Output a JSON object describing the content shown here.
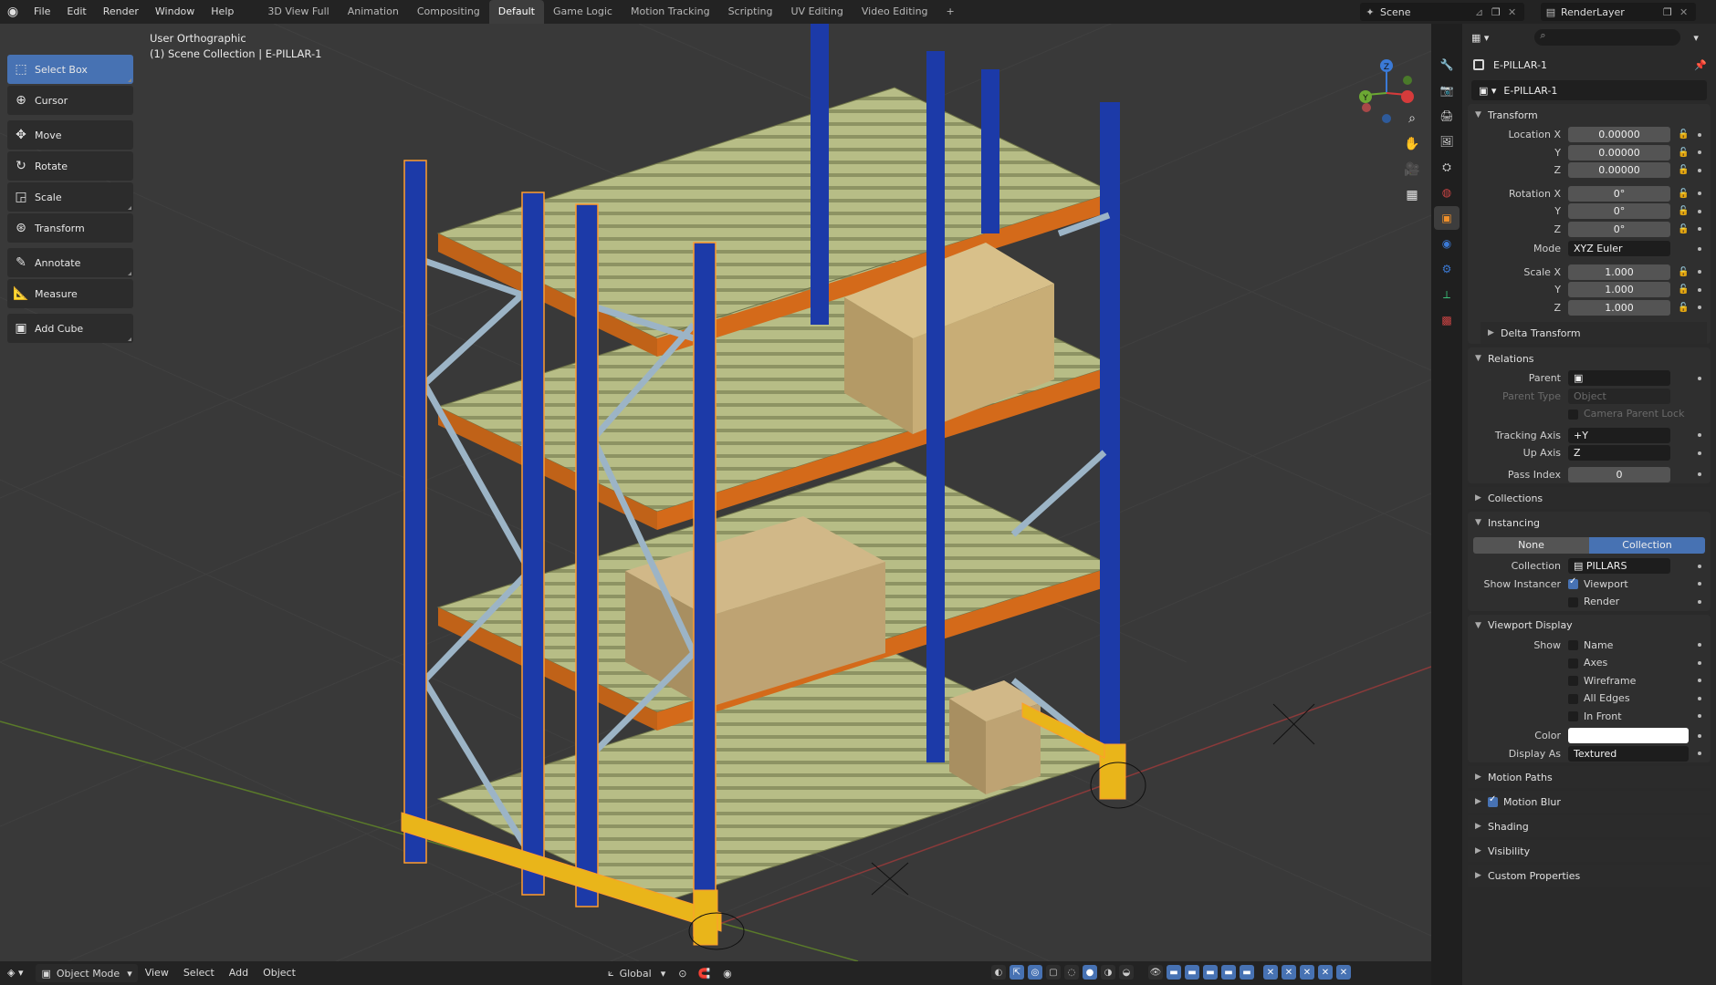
{
  "menu": [
    "File",
    "Edit",
    "Render",
    "Window",
    "Help"
  ],
  "workspaces": [
    "3D View Full",
    "Animation",
    "Compositing",
    "Default",
    "Game Logic",
    "Motion Tracking",
    "Scripting",
    "UV Editing",
    "Video Editing",
    "+"
  ],
  "active_workspace_index": 3,
  "scene_name": "Scene",
  "render_layer": "RenderLayer",
  "viewport": {
    "view_name": "User Orthographic",
    "collection_info": "(1) Scene Collection | E-PILLAR-1"
  },
  "tools": [
    {
      "label": "Select Box",
      "icon": "select-box-icon",
      "active": true
    },
    {
      "label": "Cursor",
      "icon": "cursor-icon"
    },
    {
      "label": "Move",
      "icon": "move-icon"
    },
    {
      "label": "Rotate",
      "icon": "rotate-icon"
    },
    {
      "label": "Scale",
      "icon": "scale-icon"
    },
    {
      "label": "Transform",
      "icon": "transform-icon"
    },
    {
      "label": "Annotate",
      "icon": "annotate-icon"
    },
    {
      "label": "Measure",
      "icon": "measure-icon"
    },
    {
      "label": "Add Cube",
      "icon": "add-cube-icon"
    }
  ],
  "bottom": {
    "mode": "Object Mode",
    "menus": [
      "View",
      "Select",
      "Add",
      "Object"
    ],
    "orientation": "Global"
  },
  "props": {
    "object_name": "E-PILLAR-1",
    "data_name": "E-PILLAR-1",
    "transform": {
      "title": "Transform",
      "location_label": "Location X",
      "location": [
        "0.00000",
        "0.00000",
        "0.00000"
      ],
      "rotation_label": "Rotation X",
      "rotation": [
        "0°",
        "0°",
        "0°"
      ],
      "mode_label": "Mode",
      "mode": "XYZ Euler",
      "scale_label": "Scale X",
      "scale": [
        "1.000",
        "1.000",
        "1.000"
      ],
      "axis_y": "Y",
      "axis_z": "Z"
    },
    "delta_transform": "Delta Transform",
    "relations": {
      "title": "Relations",
      "parent_label": "Parent",
      "parent_type_label": "Parent Type",
      "parent_type": "Object",
      "camera_parent_lock": "Camera Parent Lock",
      "tracking_axis_label": "Tracking Axis",
      "tracking_axis": "+Y",
      "up_axis_label": "Up Axis",
      "up_axis": "Z",
      "pass_index_label": "Pass Index",
      "pass_index": "0"
    },
    "collections": "Collections",
    "instancing": {
      "title": "Instancing",
      "options": [
        "None",
        "Collection"
      ],
      "collection_label": "Collection",
      "collection": "PILLARS",
      "show_instancer_label": "Show Instancer",
      "viewport": "Viewport",
      "render": "Render"
    },
    "viewport_display": {
      "title": "Viewport Display",
      "show_label": "Show",
      "items": [
        "Name",
        "Axes",
        "Wireframe",
        "All Edges",
        "In Front"
      ],
      "color_label": "Color",
      "color": "#ffffff",
      "display_as_label": "Display As",
      "display_as": "Textured"
    },
    "closed_panels": [
      "Motion Paths",
      "Motion Blur",
      "Shading",
      "Visibility",
      "Custom Properties"
    ]
  }
}
